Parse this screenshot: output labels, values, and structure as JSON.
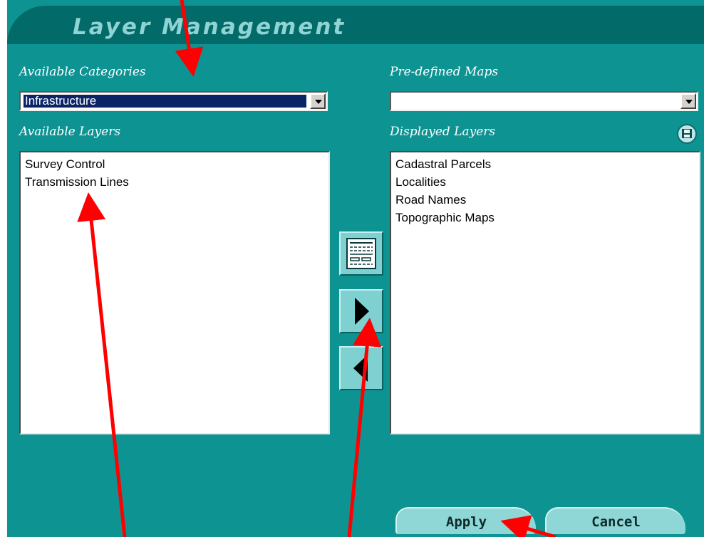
{
  "window": {
    "title": "Layer Management"
  },
  "categories": {
    "label": "Available Categories",
    "selected": "Infrastructure"
  },
  "predefined_maps": {
    "label": "Pre-defined Maps",
    "selected": ""
  },
  "available_layers": {
    "label": "Available Layers",
    "items": [
      "Survey Control",
      "Transmission Lines"
    ]
  },
  "displayed_layers": {
    "label": "Displayed Layers",
    "items": [
      "Cadastral Parcels",
      "Localities",
      "Road Names",
      "Topographic Maps"
    ]
  },
  "icons": {
    "save": "save-disk-icon",
    "properties": "layer-properties-icon",
    "add": "arrow-right-icon",
    "remove": "arrow-left-icon"
  },
  "buttons": {
    "apply": "Apply",
    "cancel": "Cancel"
  },
  "colors": {
    "panel": "#0e9393",
    "title_bar": "#036a6a",
    "annotation_arrows": "#ff0000",
    "selection": "#0a2466"
  }
}
